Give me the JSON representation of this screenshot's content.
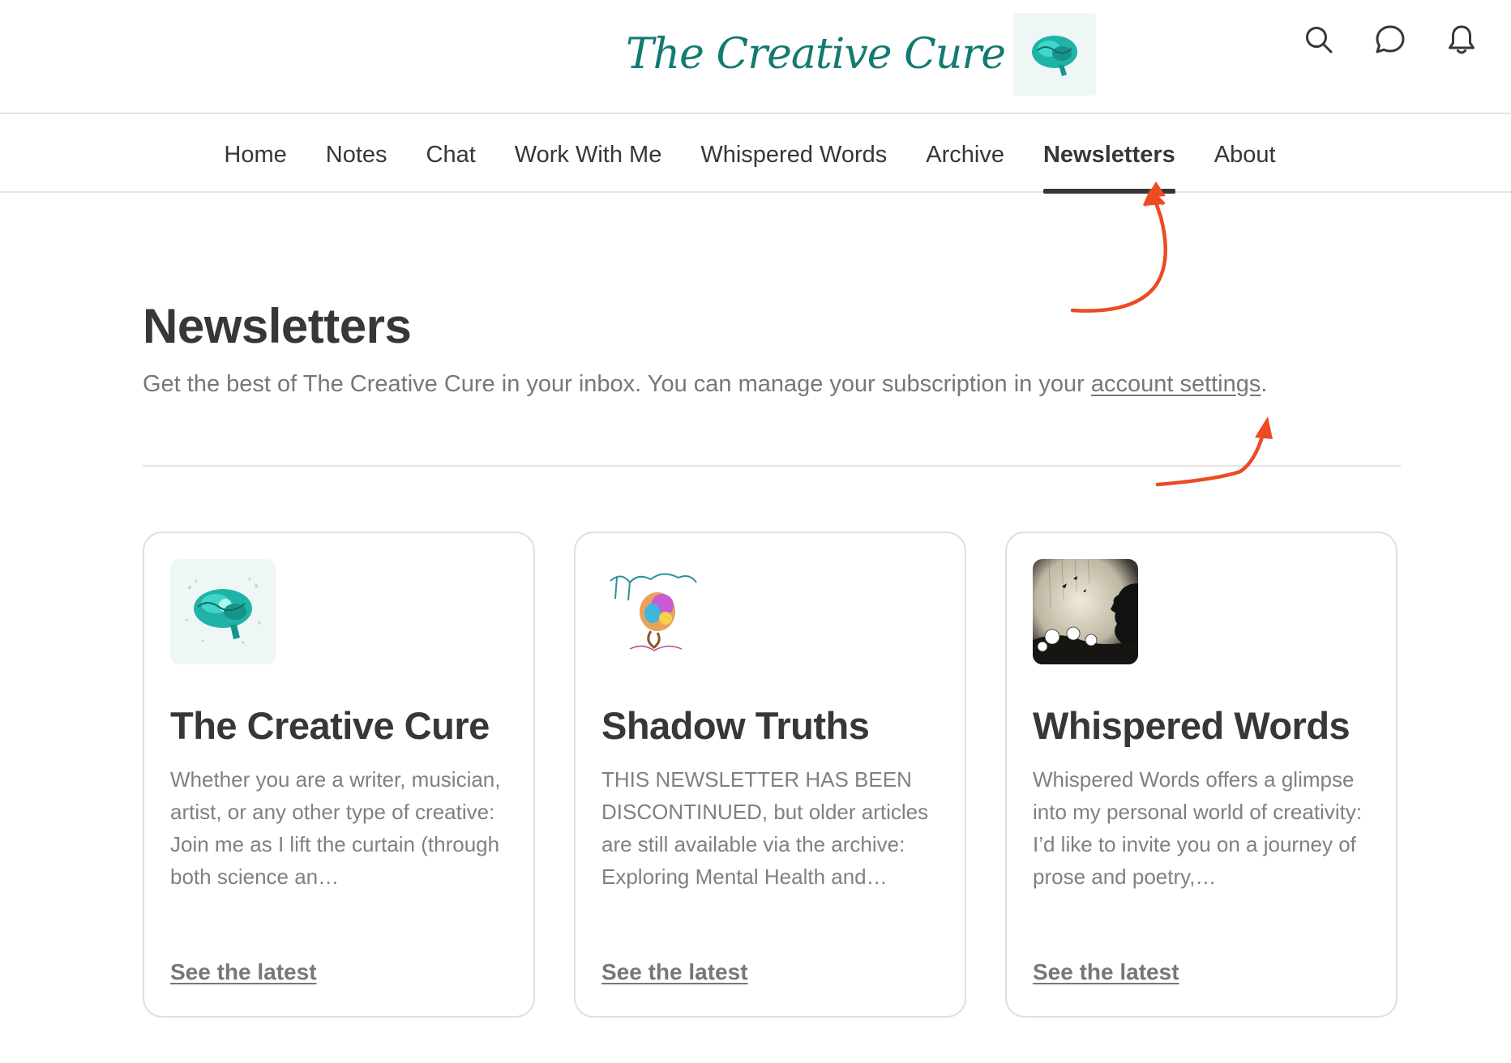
{
  "header": {
    "logo_text": "The Creative Cure",
    "logo_icon": "brain-icon",
    "icons": [
      "search-icon",
      "chat-bubble-icon",
      "bell-icon"
    ]
  },
  "nav": {
    "items": [
      {
        "label": "Home"
      },
      {
        "label": "Notes"
      },
      {
        "label": "Chat"
      },
      {
        "label": "Work With Me"
      },
      {
        "label": "Whispered Words"
      },
      {
        "label": "Archive"
      },
      {
        "label": "Newsletters",
        "active": true
      },
      {
        "label": "About"
      }
    ]
  },
  "page": {
    "title": "Newsletters",
    "subtitle_prefix": "Get the best of The Creative Cure in your inbox. You can manage your subscription in your ",
    "subtitle_link": "account settings",
    "subtitle_suffix": "."
  },
  "cards": [
    {
      "title": "The Creative Cure",
      "image": "brain-logo",
      "description": "Whether you are a writer, musician, artist, or any other type of creative: Join me as I lift the curtain (through both science an…",
      "link": "See the latest"
    },
    {
      "title": "Shadow Truths",
      "image": "the-sandman-shadow-truths-logo",
      "description": "THIS NEWSLETTER HAS BEEN DISCONTINUED, but older articles are still available via the archive: Exploring Mental Health and…",
      "link": "See the latest"
    },
    {
      "title": "Whispered Words",
      "image": "silhouette-dandelions-image",
      "description": "Whispered Words offers a glimpse into my personal world of creativity: I’d like to invite you on a journey of prose and poetry,…",
      "link": "See the latest"
    }
  ],
  "colors": {
    "text": "#363737",
    "muted": "#777777",
    "brand": "#137a72",
    "annotation_arrow": "#ee4a24"
  }
}
